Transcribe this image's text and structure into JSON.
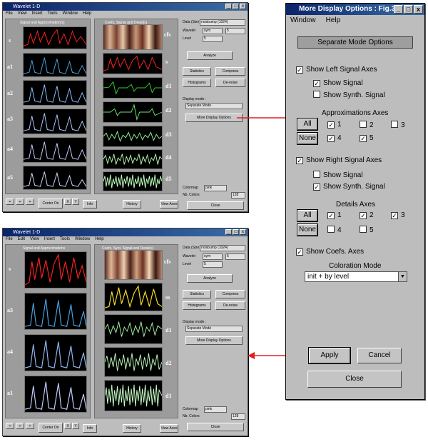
{
  "top_window": {
    "title": "Wavelet 1-D",
    "menus": [
      "File",
      "View",
      "Insert",
      "Tools",
      "Window",
      "Help"
    ],
    "left_panel_title": "Signal and Approximation(s)",
    "right_panel_title": "Coefs, Signal and Detail(s)",
    "left_labels": [
      "s",
      "a1",
      "a2",
      "a3",
      "a4",
      "a5"
    ],
    "right_labels": [
      "cfs",
      "s",
      "d1",
      "d2",
      "d3",
      "d4",
      "d5"
    ],
    "controls": {
      "data_label": "Data (Size)",
      "data_value": "noisbump (1024)",
      "wavelet_label": "Wavelet",
      "wavelet_value": "sym",
      "wavelet_num": "5",
      "level_label": "Level",
      "level_value": "5",
      "analyze": "Analyze",
      "statistics": "Statistics",
      "compress": "Compress",
      "histograms": "Histograms",
      "denoise": "De-noise",
      "display_mode_label": "Display mode :",
      "display_mode_value": "Separate Mode",
      "more_display": "More Display Options",
      "colormap_label": "Colormap",
      "colormap_value": "pink",
      "nb_colors_label": "Nb. Colors",
      "nb_colors_value": "128",
      "close": "Close",
      "center_on": "Center On",
      "x": "X",
      "y": "Y",
      "info": "Info",
      "history": "History",
      "view_axes": "View Axes"
    }
  },
  "bottom_window": {
    "title": "Wavelet 1-D",
    "menus": [
      "File",
      "Edit",
      "View",
      "Insert",
      "Tools",
      "Window",
      "Help"
    ],
    "left_panel_title": "Signal and Approximations",
    "right_panel_title": "Coefs, Synt. Signal and Detail(s)",
    "left_labels": [
      "s",
      "a3",
      "a4",
      "a1"
    ],
    "right_labels": [
      "cfs",
      "ss",
      "d1",
      "d2",
      "d1"
    ],
    "controls": {
      "data_label": "Data (Size)",
      "data_value": "noisbump (1024)",
      "wavelet_label": "Wavelet",
      "wavelet_value": "sym",
      "wavelet_num": "5",
      "level_label": "Level",
      "level_value": "5",
      "analyze": "Analyze",
      "statistics": "Statistics",
      "compress": "Compress",
      "histograms": "Histograms",
      "denoise": "De-noise",
      "display_mode_label": "Display mode :",
      "display_mode_value": "Separate Mode",
      "more_display": "More Display Options",
      "colormap_label": "Colormap",
      "colormap_value": "pink",
      "nb_colors_label": "Nb. Colors",
      "nb_colors_value": "128",
      "close": "Close",
      "center_on": "Center On",
      "x": "X",
      "y": "Y",
      "info": "Info",
      "history": "History",
      "view_axes": "View Axes"
    }
  },
  "dialog": {
    "title": "More Display Options : Fig.3",
    "menus": [
      "Window",
      "Help"
    ],
    "header": "Separate Mode Options",
    "show_left": "Show Left Signal Axes",
    "show_signal_1": "Show Signal",
    "show_synth_1": "Show Synth. Signal",
    "approx_title": "Approximations Axes",
    "all_1": "All",
    "none_1": "None",
    "approx_nums": [
      "1",
      "2",
      "3",
      "4",
      "5"
    ],
    "show_right": "Show Right Signal Axes",
    "show_signal_2": "Show Signal",
    "show_synth_2": "Show Synth. Signal",
    "details_title": "Details Axes",
    "all_2": "All",
    "none_2": "None",
    "detail_nums": [
      "1",
      "2",
      "3",
      "4",
      "5"
    ],
    "show_coefs": "Show Coefs. Axes",
    "coloration_label": "Coloration Mode",
    "coloration_value": "init + by level",
    "apply": "Apply",
    "cancel": "Cancel",
    "close": "Close"
  },
  "colors": {
    "arrow": "#e02020",
    "title_bar": "#0a246a"
  }
}
